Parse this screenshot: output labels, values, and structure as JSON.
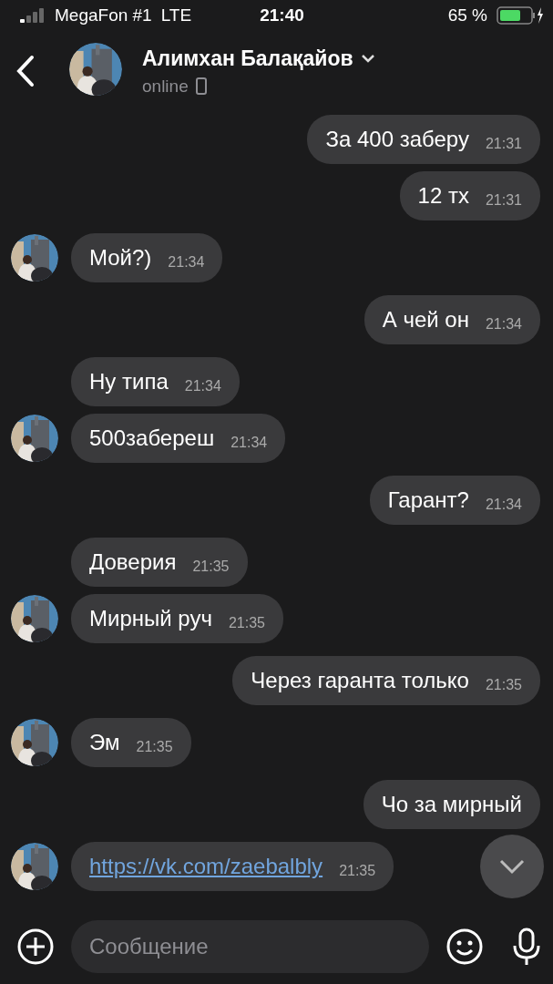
{
  "status_bar": {
    "carrier": "MegaFon #1",
    "network": "LTE",
    "time": "21:40",
    "battery": "65 %"
  },
  "header": {
    "name": "Алимхан Балақайов",
    "status": "online"
  },
  "messages": [
    {
      "kind": "out",
      "text": "За 400 заберу",
      "time": "21:31"
    },
    {
      "kind": "out",
      "text": "12 тх",
      "time": "21:31"
    },
    {
      "kind": "in",
      "text": "Мой?)",
      "time": "21:34"
    },
    {
      "kind": "out",
      "text": "А чей он",
      "time": "21:34"
    },
    {
      "kind": "in",
      "text": "Ну типа",
      "time": "21:34"
    },
    {
      "kind": "in",
      "text": "500забереш",
      "time": "21:34"
    },
    {
      "kind": "out",
      "text": "Гарант?",
      "time": "21:34"
    },
    {
      "kind": "in",
      "text": "Доверия",
      "time": "21:35"
    },
    {
      "kind": "in",
      "text": "Мирный руч",
      "time": "21:35"
    },
    {
      "kind": "out",
      "text": "Через гаранта только",
      "time": "21:35"
    },
    {
      "kind": "in",
      "text": "Эм",
      "time": "21:35"
    },
    {
      "kind": "out",
      "text": "Чо за мирный"
    },
    {
      "kind": "link",
      "text": "https://vk.com/zaebalbly",
      "time": "21:35"
    }
  ],
  "composer": {
    "placeholder": "Сообщение"
  }
}
